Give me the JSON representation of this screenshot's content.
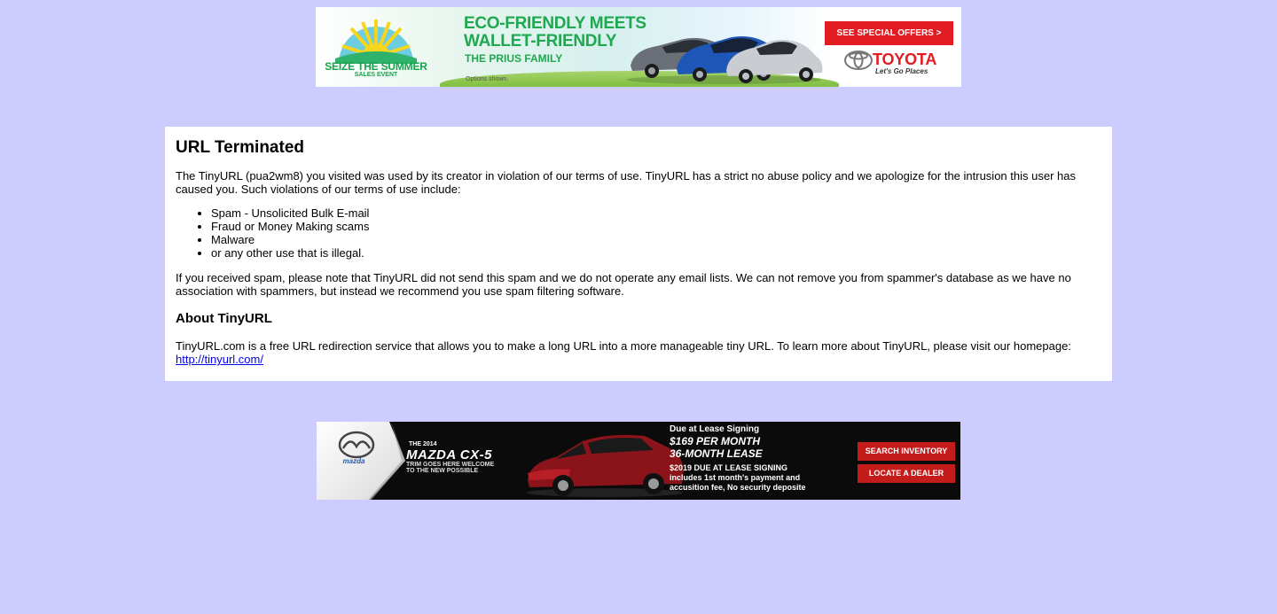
{
  "top_ad": {
    "event_title": "SEIZE THE SUMMER",
    "event_subtitle": "SALES EVENT",
    "headline_line1": "ECO-FRIENDLY MEETS",
    "headline_line2": "WALLET-FRIENDLY",
    "subheadline": "THE PRIUS FAMILY",
    "disclaimer": "Options shown.",
    "cta": "SEE SPECIAL OFFERS >",
    "brand": "TOYOTA",
    "tagline": "Let's Go Places",
    "colors": {
      "cta_bg": "#e31b23",
      "headline": "#1fa84f"
    }
  },
  "page": {
    "title": "URL Terminated",
    "intro": "The TinyURL (pua2wm8) you visited was used by its creator in violation of our terms of use. TinyURL has a strict no abuse policy and we apologize for the intrusion this user has caused you. Such violations of our terms of use include:",
    "violations": [
      "Spam - Unsolicited Bulk E-mail",
      "Fraud or Money Making scams",
      "Malware",
      "or any other use that is illegal."
    ],
    "spam_note": "If you received spam, please note that TinyURL did not send this spam and we do not operate any email lists. We can not remove you from spammer's database as we have no association with spammers, but instead we recommend you use spam filtering software.",
    "about_heading": "About TinyURL",
    "about_text": "TinyURL.com is a free URL redirection service that allows you to make a long URL into a more manageable tiny URL. To learn more about TinyURL, please visit our homepage:",
    "homepage_link": "http://tinyurl.com/"
  },
  "bottom_ad": {
    "brand": "mazda",
    "year_line": "THE 2014",
    "model": "MAZDA CX-5",
    "trim_note": "TRIM GOES HERE WELCOME TO THE NEW POSSIBLE",
    "due_label": "Due at Lease Signing",
    "price_line1": "$169  PER MONTH",
    "price_line2": "36-MONTH LEASE",
    "fine_line1": "$2019 DUE AT LEASE SIGNING",
    "fine_line2": "includes 1st month's payment and",
    "fine_line3": "accusition fee, No security deposite",
    "button_search": "SEARCH INVENTORY",
    "button_dealer": "LOCATE A DEALER",
    "colors": {
      "button_bg": "#c41b1b",
      "background": "#0b0b0b"
    }
  },
  "colors": {
    "page_background": "#ccccff",
    "link": "#0000ee"
  }
}
